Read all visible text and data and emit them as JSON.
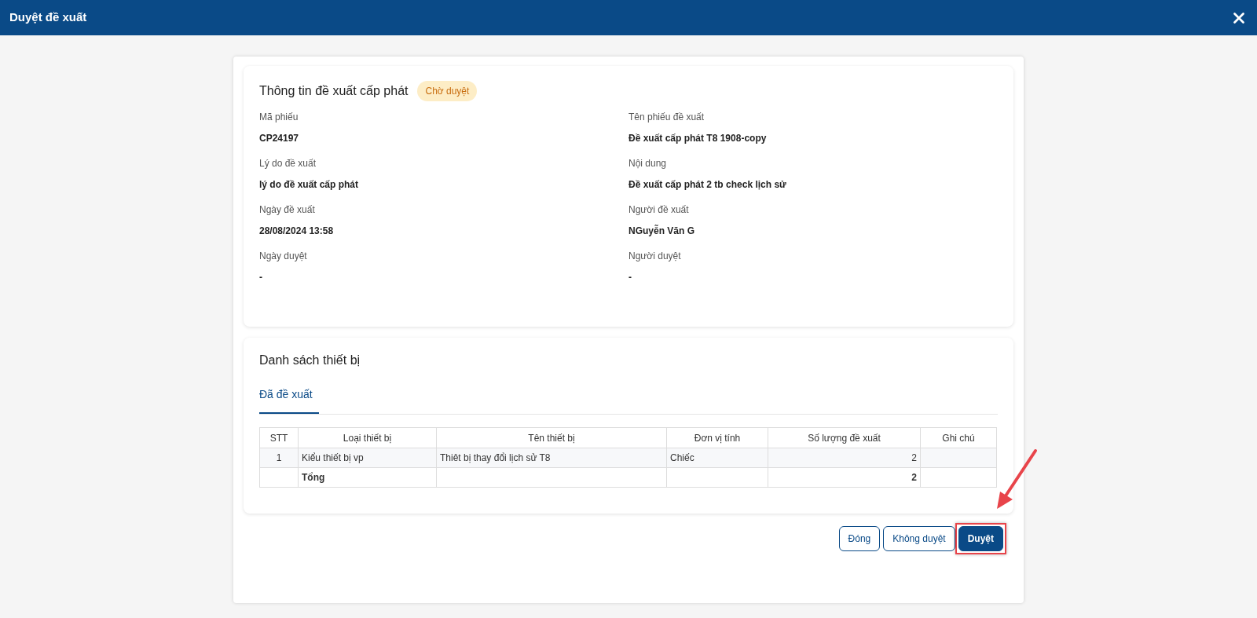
{
  "window": {
    "title": "Duyệt đề xuất"
  },
  "info": {
    "title": "Thông tin đề xuất cấp phát",
    "status": "Chờ duyệt",
    "fields": [
      {
        "label": "Mã phiếu",
        "value": "CP24197"
      },
      {
        "label": "Tên phiếu đề xuất",
        "value": "Đề xuất cấp phát T8 1908-copy"
      },
      {
        "label": "Lý do đề xuất",
        "value": "lý do đề xuất cấp phát"
      },
      {
        "label": "Nội dung",
        "value": "Đề xuất cấp phát 2 tb check lịch sử"
      },
      {
        "label": "Ngày đề xuất",
        "value": "28/08/2024 13:58"
      },
      {
        "label": "Người đề xuất",
        "value": "NGuyễn Văn G"
      },
      {
        "label": "Ngày duyệt",
        "value": "-"
      },
      {
        "label": "Người duyệt",
        "value": "-"
      }
    ]
  },
  "devices": {
    "title": "Danh sách thiết bị",
    "tabs": [
      {
        "label": "Đã đề xuất",
        "selected": true
      }
    ],
    "table": {
      "columns": [
        "STT",
        "Loại thiết bị",
        "Tên thiết bị",
        "Đơn vị tính",
        "Số lượng đề xuất",
        "Ghi chú"
      ],
      "rows": [
        {
          "kind": "item",
          "cells": [
            "1",
            "Kiểu thiết bị vp",
            "Thiêt bị thay đổi lịch sử T8",
            "Chiếc",
            "2",
            ""
          ]
        },
        {
          "kind": "total",
          "cells": [
            "",
            "Tổng",
            "",
            "",
            "2",
            ""
          ]
        }
      ]
    }
  },
  "buttons": [
    {
      "label": "Đóng",
      "kind": "outline"
    },
    {
      "label": "Không duyệt",
      "kind": "outline"
    },
    {
      "label": "Duyệt",
      "kind": "primary",
      "highlighted": true
    }
  ]
}
